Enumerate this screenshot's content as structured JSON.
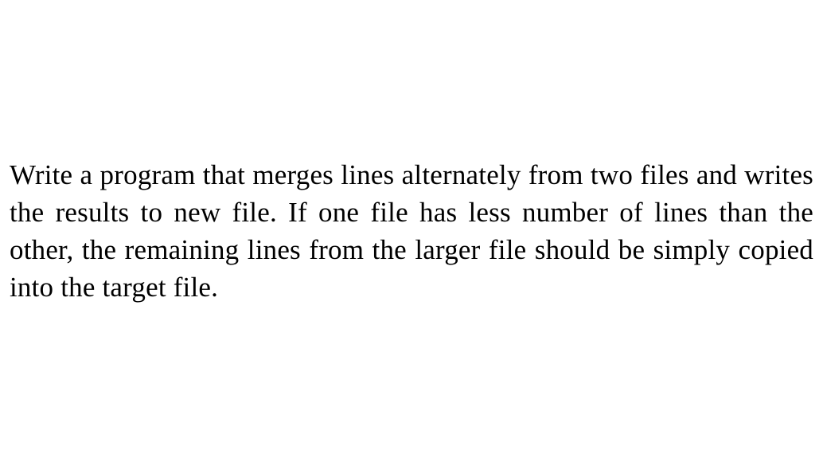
{
  "document": {
    "paragraph": "Write a program that merges lines alternately from two files and writes the results to new file. If one file has less number of lines than the other, the remaining lines from the larger file should be simply copied into the target file."
  }
}
